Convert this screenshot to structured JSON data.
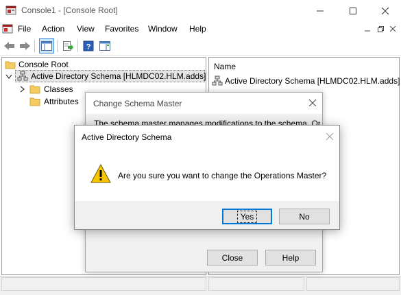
{
  "window": {
    "title": "Console1 - [Console Root]",
    "controls": [
      "minimize",
      "maximize",
      "close"
    ]
  },
  "menubar": {
    "items": [
      "File",
      "Action",
      "View",
      "Favorites",
      "Window",
      "Help"
    ]
  },
  "toolbar": {
    "buttons": [
      "back-icon",
      "forward-icon",
      "show-hide-tree-icon",
      "export-list-icon",
      "help-icon",
      "action-pane-icon"
    ]
  },
  "tree": {
    "root": "Console Root",
    "schema_node": "Active Directory Schema [HLMDC02.HLM.adds]",
    "children": [
      "Classes",
      "Attributes"
    ]
  },
  "list": {
    "column_header": "Name",
    "items": [
      "Active Directory Schema [HLMDC02.HLM.adds]"
    ]
  },
  "schema_master_dialog": {
    "title": "Change Schema Master",
    "text": "The schema master manages modifications to the schema. Only one",
    "close_label": "Close",
    "help_label": "Help"
  },
  "confirm_dialog": {
    "title": "Active Directory Schema",
    "message": "Are you sure you want to change the Operations Master?",
    "yes_label": "Yes",
    "no_label": "No"
  },
  "colors": {
    "accent": "#0078d7",
    "folder": "#f2cc62",
    "warning": "#f7c600"
  }
}
